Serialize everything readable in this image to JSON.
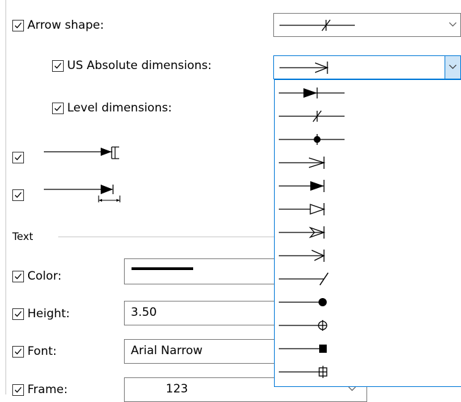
{
  "arrow_shape": {
    "label": "Arrow shape:",
    "checked": true,
    "icon": "tick-slash-arrow"
  },
  "us_absolute": {
    "label": "US Absolute dimensions:",
    "checked": true,
    "icon": "open-arrow-bar"
  },
  "level_dimensions": {
    "label": "Level dimensions:",
    "checked": true
  },
  "arrow_row_1": {
    "checked": true,
    "icon": "filled-arrow-bracket"
  },
  "arrow_row_2": {
    "checked": true,
    "icon": "filled-arrow-dimension"
  },
  "text_group": {
    "label": "Text"
  },
  "color_field": {
    "label": "Color:",
    "checked": true,
    "value": "#000000"
  },
  "height_field": {
    "label": "Height:",
    "checked": true,
    "value": "3.50"
  },
  "font_field": {
    "label": "Font:",
    "checked": true,
    "value": "Arial Narrow"
  },
  "frame_field": {
    "label": "Frame:",
    "checked": true,
    "value": "123"
  },
  "arrow_options": [
    "filled-arrow-cross",
    "slash-cross",
    "dot-cross",
    "open-arrow-bar",
    "filled-arrow-bar",
    "hollow-arrow-bar",
    "barbed-arrow-bar",
    "half-arrow-bar",
    "slash-end",
    "dot-end",
    "circle-plus-end",
    "square-end",
    "square-plus-end"
  ],
  "colors": {
    "accent": "#0078d7",
    "highlight": "#cce4f7",
    "border": "#7a7a7a",
    "divider": "#c8c8c8"
  }
}
